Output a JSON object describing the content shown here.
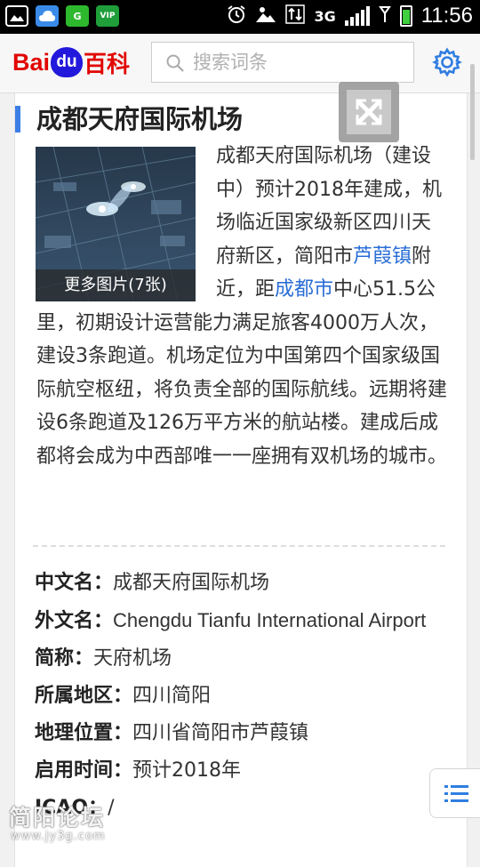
{
  "status_bar": {
    "time": "11:56",
    "network": "3G",
    "icons": [
      "gallery-icon",
      "cloud-icon",
      "g-app-icon",
      "vip-shield-icon",
      "alarm-icon",
      "weather-icon",
      "data-transfer-icon",
      "signal-icon",
      "battery-icon"
    ],
    "vip_label": "VIP"
  },
  "header": {
    "logo_bai": "Bai",
    "logo_du": "du",
    "logo_baike": "百科",
    "search_placeholder": "搜索词条"
  },
  "article": {
    "title": "成都天府国际机场",
    "image_caption": "更多图片(7张)",
    "summary_part1": "成都天府国际机场（建设中）预计2018年建成，机场临近国家级新区四川天府新区，简阳市",
    "link1": "芦葭镇",
    "summary_part2": "附近，距",
    "link2": "成都市",
    "summary_part3": "中心51.5公里，初期设计运营能力满足旅客4000万人次，建设3条跑道。机场定位为中国第四个国家级国际航空枢纽，将负责全部的国际航线。远期将建设6条跑道及126万平方米的航站楼。建成后成都将会成为中西部唯一一座拥有双机场的城市。"
  },
  "infobox": [
    {
      "label": "中文名：",
      "value": "成都天府国际机场"
    },
    {
      "label": "外文名：",
      "value": "Chengdu Tianfu International Airport"
    },
    {
      "label": "简称：",
      "value": "天府机场"
    },
    {
      "label": "所属地区：",
      "value": "四川简阳"
    },
    {
      "label": "地理位置：",
      "value": "四川省简阳市芦葭镇"
    },
    {
      "label": "启用时间：",
      "value": "预计2018年"
    },
    {
      "label": "ICAO：",
      "value": "/"
    }
  ],
  "watermark": {
    "text": "简阳论坛",
    "url": "www.jy3g.com"
  },
  "colors": {
    "accent_blue": "#3c7de6",
    "link_blue": "#2a6ed6",
    "baidu_red": "#e10601",
    "baidu_blue": "#2319dc"
  }
}
